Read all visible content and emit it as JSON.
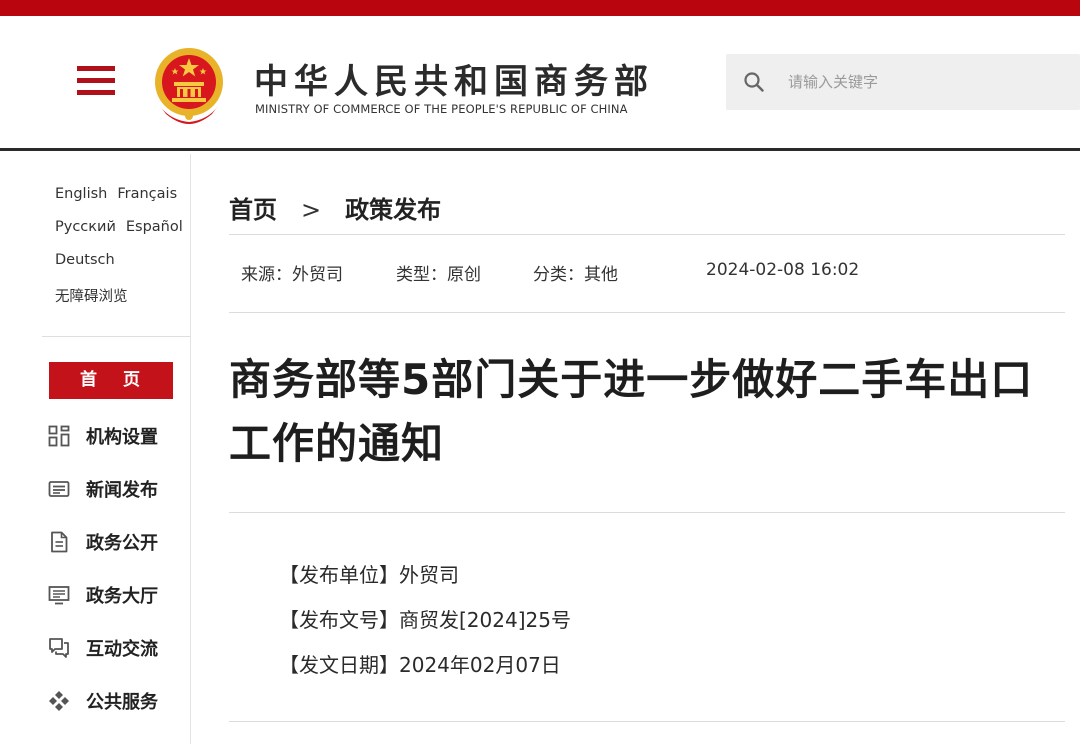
{
  "header": {
    "title": "中华人民共和国商务部",
    "subtitle": "MINISTRY OF COMMERCE OF THE PEOPLE'S REPUBLIC OF CHINA",
    "search_placeholder": "请输入关键字",
    "search_value": ""
  },
  "languages": {
    "row1": [
      "English",
      "Français"
    ],
    "row2": [
      "Русский",
      "Español"
    ],
    "row3": [
      "Deutsch"
    ],
    "accessibility": "无障碍浏览"
  },
  "nav": {
    "home": "首 页",
    "items": [
      {
        "label": "机构设置",
        "icon": "grid-icon"
      },
      {
        "label": "新闻发布",
        "icon": "newspaper-icon"
      },
      {
        "label": "政务公开",
        "icon": "document-icon"
      },
      {
        "label": "政务大厅",
        "icon": "monitor-icon"
      },
      {
        "label": "互动交流",
        "icon": "chat-icon"
      },
      {
        "label": "公共服务",
        "icon": "diamond-arrows-icon"
      }
    ]
  },
  "breadcrumb": {
    "home": "首页",
    "separator": ">",
    "current": "政策发布"
  },
  "meta": {
    "source": "来源：外贸司",
    "type": "类型：原创",
    "category": "分类：其他",
    "datetime": "2024-02-08 16:02"
  },
  "article": {
    "title": "商务部等5部门关于进一步做好二手车出口工作的通知",
    "issuer": "【发布单位】外贸司",
    "doc_number": "【发布文号】商贸发[2024]25号",
    "issue_date": "【发文日期】2024年02月07日"
  },
  "colors": {
    "brand_red": "#b8050e",
    "nav_red": "#c4121b"
  }
}
